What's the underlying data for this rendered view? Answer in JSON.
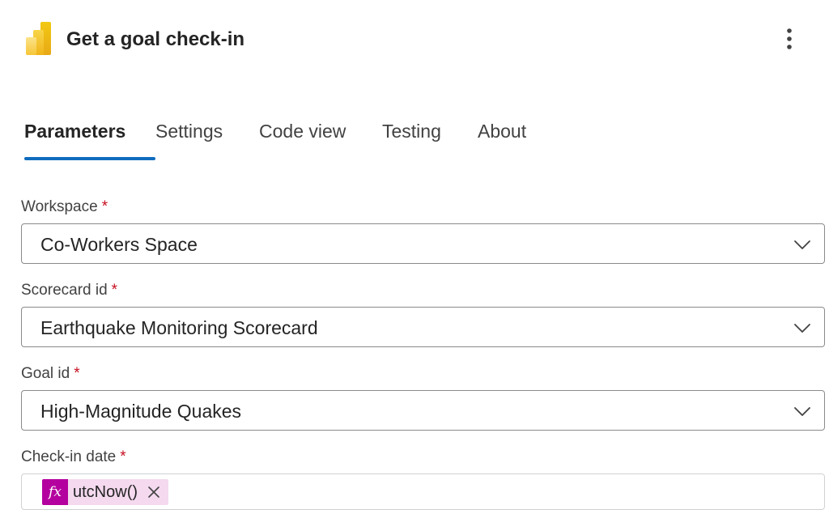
{
  "header": {
    "title": "Get a goal check-in",
    "logo_icon": "power-bi-logo-icon",
    "more_icon": "more-vertical-icon"
  },
  "tabs": [
    {
      "label": "Parameters",
      "active": true
    },
    {
      "label": "Settings",
      "active": false
    },
    {
      "label": "Code view",
      "active": false
    },
    {
      "label": "Testing",
      "active": false
    },
    {
      "label": "About",
      "active": false
    }
  ],
  "fields": {
    "workspace": {
      "label": "Workspace",
      "required": "*",
      "value": "Co-Workers Space"
    },
    "scorecard": {
      "label": "Scorecard id",
      "required": "*",
      "value": "Earthquake Monitoring Scorecard"
    },
    "goal": {
      "label": "Goal id",
      "required": "*",
      "value": "High-Magnitude Quakes"
    },
    "checkin_date": {
      "label": "Check-in date",
      "required": "*",
      "token": {
        "fx": "fx",
        "text": "utcNow()"
      }
    }
  },
  "colors": {
    "accent": "#0f6cbd",
    "required": "#c50f1f",
    "token_bg": "#f4d9ef",
    "token_fx_bg": "#b4009e"
  }
}
